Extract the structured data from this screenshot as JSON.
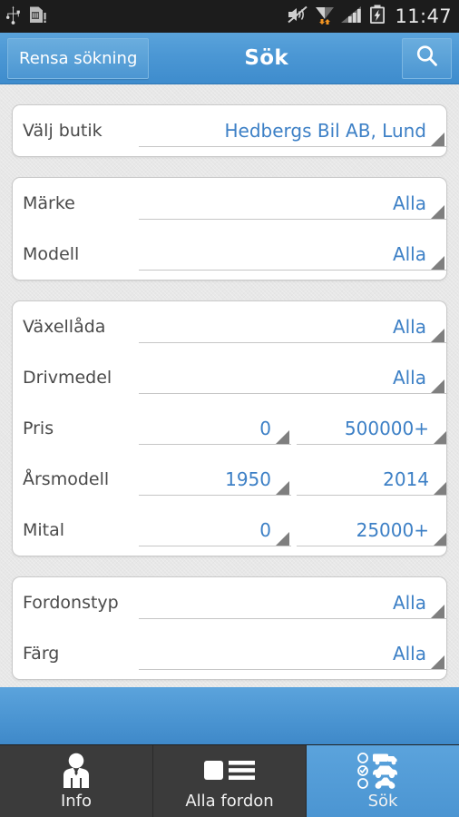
{
  "statusbar": {
    "left_icons": [
      "usb-icon",
      "sd-card-icon"
    ],
    "right_icons": [
      "volume-mute-icon",
      "wifi-icon",
      "signal-bars-icon",
      "battery-charging-icon"
    ],
    "time": "11:47"
  },
  "actionbar": {
    "clear_label": "Rensa sökning",
    "title": "Sök",
    "search_icon": "search-icon"
  },
  "colors": {
    "accent_blue": "#4b95d2",
    "value_blue": "#3d80c6",
    "label_gray": "#4a4a4a",
    "page_bg": "#e7e7e7",
    "nav_bg": "#3b3b3b"
  },
  "groups": [
    {
      "id": "store",
      "rows": [
        {
          "label": "Välj butik",
          "type": "single",
          "value": "Hedbergs Bil AB, Lund"
        }
      ]
    },
    {
      "id": "make-model",
      "rows": [
        {
          "label": "Märke",
          "type": "single",
          "value": "Alla"
        },
        {
          "label": "Modell",
          "type": "single",
          "value": "Alla"
        }
      ]
    },
    {
      "id": "specs",
      "rows": [
        {
          "label": "Växellåda",
          "type": "single",
          "value": "Alla"
        },
        {
          "label": "Drivmedel",
          "type": "single",
          "value": "Alla"
        },
        {
          "label": "Pris",
          "type": "range",
          "min": "0",
          "max": "500000+"
        },
        {
          "label": "Årsmodell",
          "type": "range",
          "min": "1950",
          "max": "2014"
        },
        {
          "label": "Mital",
          "type": "range",
          "min": "0",
          "max": "25000+"
        }
      ]
    },
    {
      "id": "type-color",
      "rows": [
        {
          "label": "Fordonstyp",
          "type": "single",
          "value": "Alla"
        },
        {
          "label": "Färg",
          "type": "single",
          "value": "Alla"
        }
      ]
    }
  ],
  "navbar": {
    "items": [
      {
        "label": "Info",
        "icon": "person-suit-icon",
        "active": false
      },
      {
        "label": "Alla fordon",
        "icon": "list-icon",
        "active": false
      },
      {
        "label": "Sök",
        "icon": "vehicle-select-icon",
        "active": true
      }
    ]
  }
}
